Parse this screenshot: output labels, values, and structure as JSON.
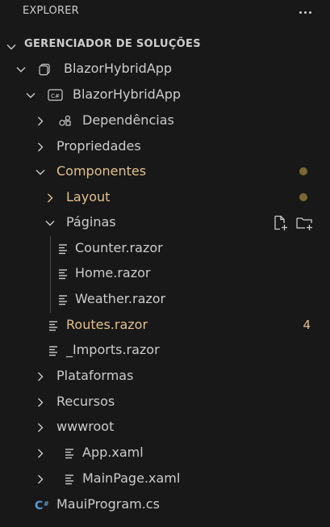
{
  "header": {
    "title": "EXPLORER"
  },
  "section": {
    "title": "GERENCIADOR DE SOLUÇÕES"
  },
  "tree": {
    "solution": "BlazorHybridApp",
    "project": "BlazorHybridApp",
    "dependencies": "Dependências",
    "properties": "Propriedades",
    "components": "Componentes",
    "layout": "Layout",
    "pages": "Páginas",
    "counter": "Counter.razor",
    "home": "Home.razor",
    "weather": "Weather.razor",
    "routes": "Routes.razor",
    "routes_problems": "4",
    "imports": "_Imports.razor",
    "platforms": "Plataformas",
    "resources": "Recursos",
    "wwwroot": "wwwroot",
    "app": "App.xaml",
    "mainpage": "MainPage.xaml",
    "mauiprogram": "MauiProgram.cs"
  },
  "colors": {
    "background": "#181818",
    "text": "#cccccc",
    "modified": "#e2c08d",
    "csharp": "#5a9bd6"
  }
}
